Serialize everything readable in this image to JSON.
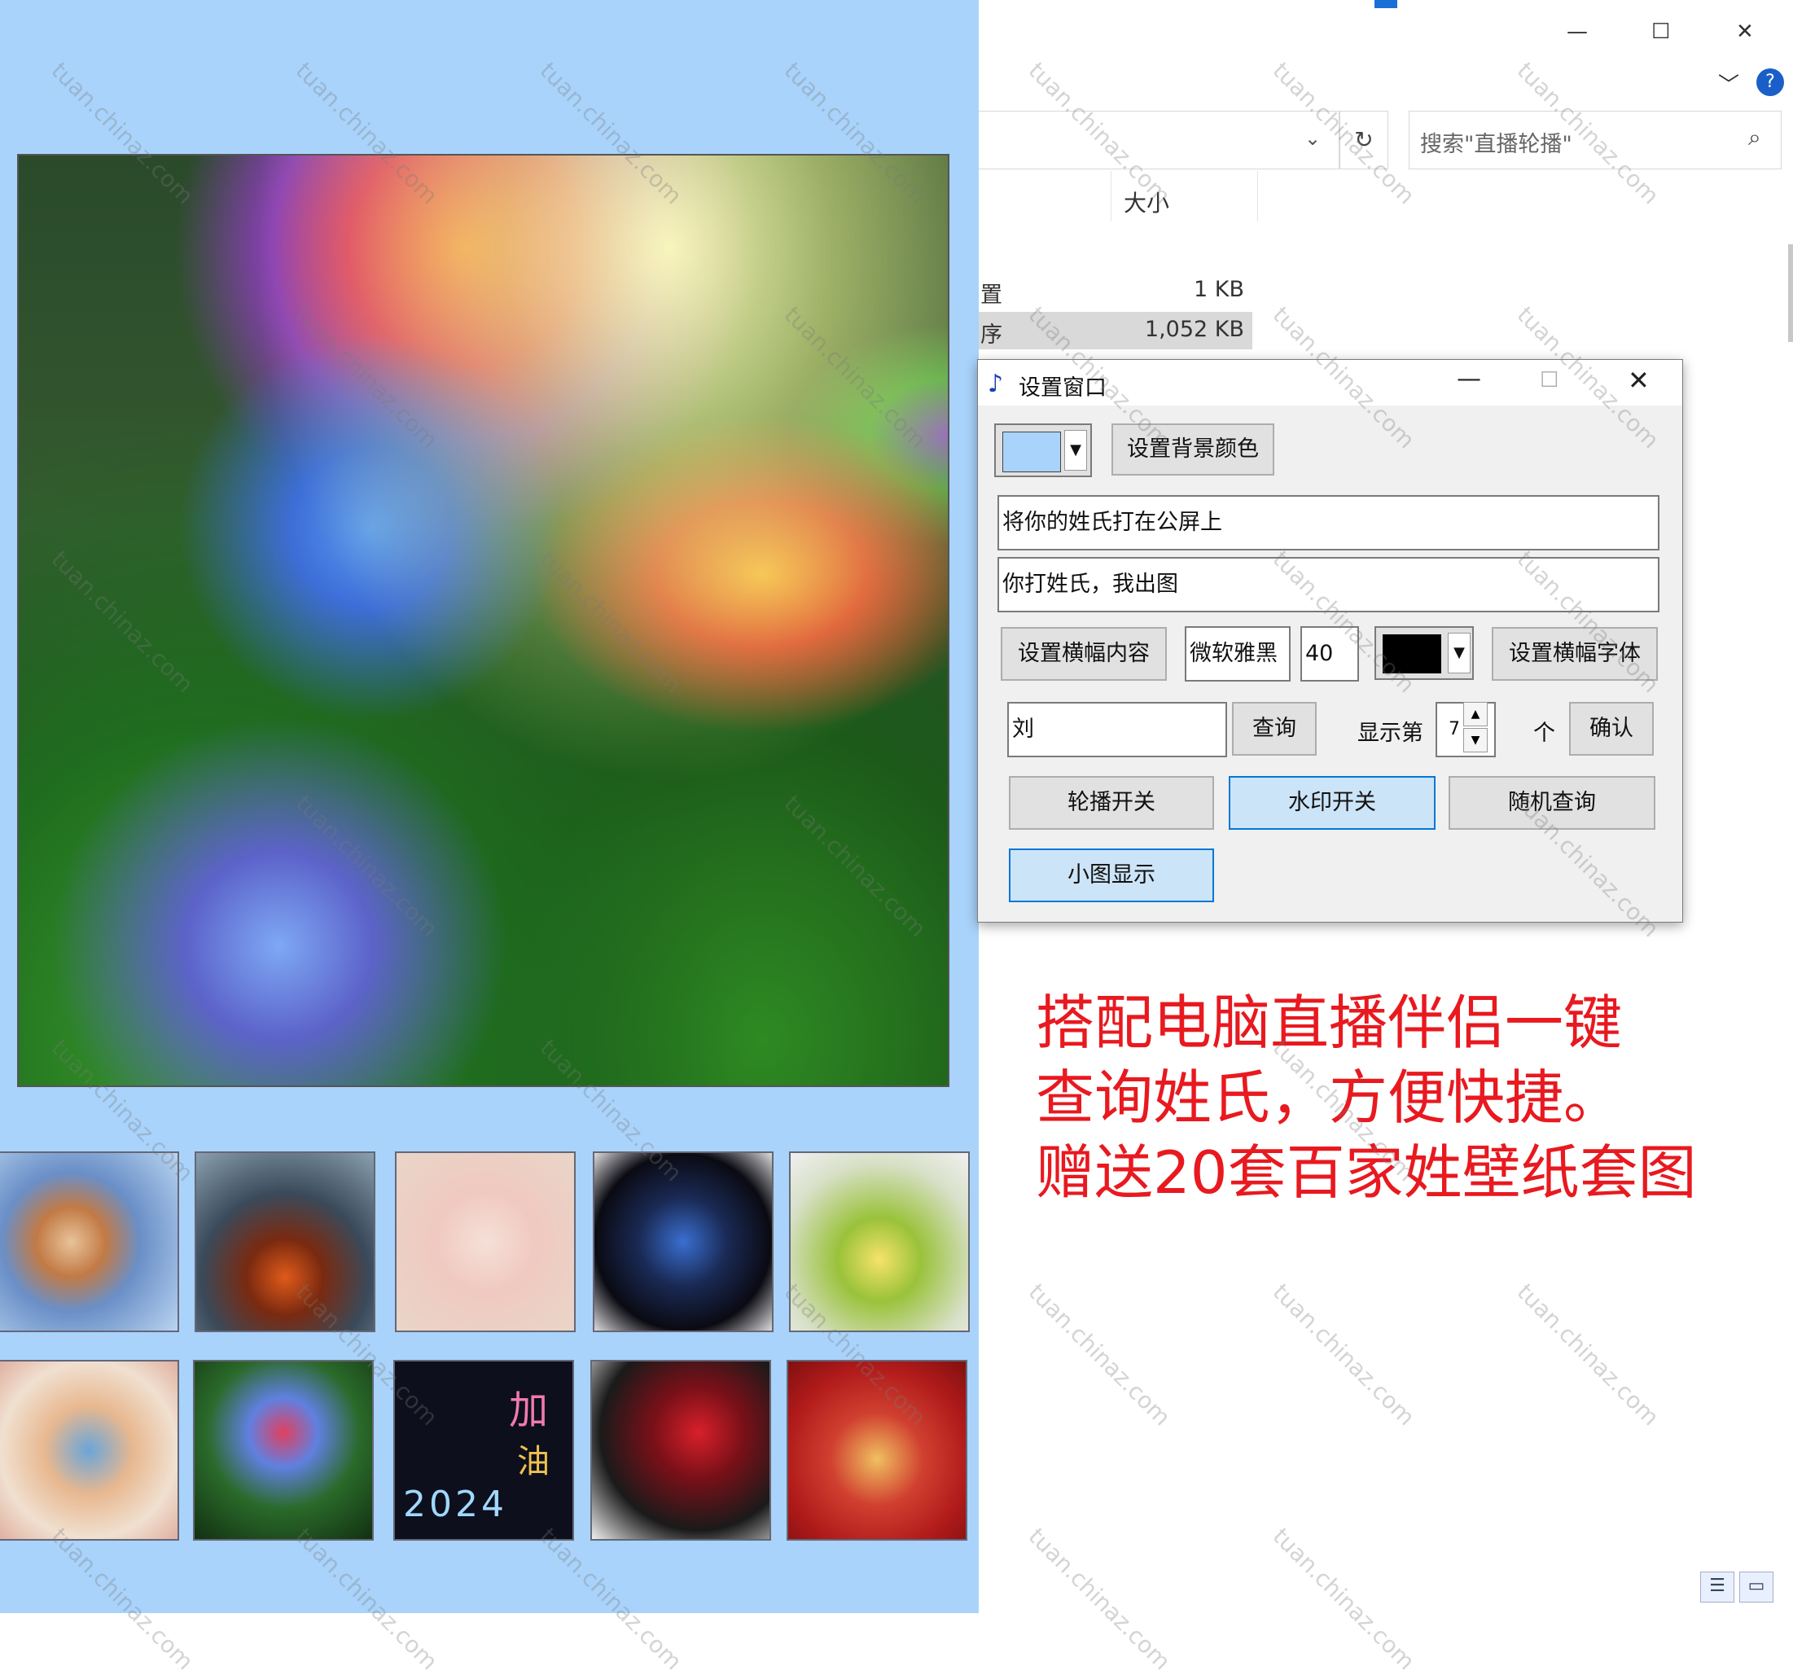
{
  "left_panel": {
    "background_color": "#a9d3fb",
    "main_image": "surname wallpaper preview",
    "thumbnails": [
      {
        "row": 1,
        "col": 1
      },
      {
        "row": 1,
        "col": 2
      },
      {
        "row": 1,
        "col": 3
      },
      {
        "row": 1,
        "col": 4
      },
      {
        "row": 1,
        "col": 5
      },
      {
        "row": 2,
        "col": 1
      },
      {
        "row": 2,
        "col": 2
      },
      {
        "row": 2,
        "col": 3,
        "caption1": "加",
        "caption2": "油",
        "caption3": "2024"
      },
      {
        "row": 2,
        "col": 4
      },
      {
        "row": 2,
        "col": 5
      }
    ]
  },
  "explorer": {
    "window_controls": {
      "minimize": "—",
      "maximize": "☐",
      "close": "✕"
    },
    "help": "?",
    "chevron": "﹀",
    "search_placeholder": "搜索\"直播轮播\"",
    "column_size": "大小",
    "files": [
      {
        "name": "置",
        "size": "1 KB"
      },
      {
        "name": "序",
        "size": "1,052 KB"
      }
    ]
  },
  "dialog": {
    "title": "设置窗口",
    "set_bg_color": "设置背景颜色",
    "text1": "将你的姓氏打在公屏上",
    "text2": "你打姓氏，我出图",
    "set_banner_content": "设置横幅内容",
    "font_name": "微软雅黑",
    "font_size": "40",
    "set_banner_font": "设置横幅字体",
    "surname_value": "刘",
    "query": "查询",
    "show_nth": "显示第",
    "nth_value": "7",
    "unit": "个",
    "confirm": "确认",
    "carousel_toggle": "轮播开关",
    "watermark_toggle": "水印开关",
    "random_query": "随机查询",
    "small_display": "小图显示",
    "bg_swatch_color": "#a9d3fb",
    "font_swatch_color": "#000000"
  },
  "promo": {
    "line1": "搭配电脑直播伴侣一键",
    "line2": "查询姓氏，方便快捷。",
    "line3": "赠送20套百家姓壁纸套图",
    "color": "#e8191f"
  },
  "watermark": "tuan.chinaz.com"
}
